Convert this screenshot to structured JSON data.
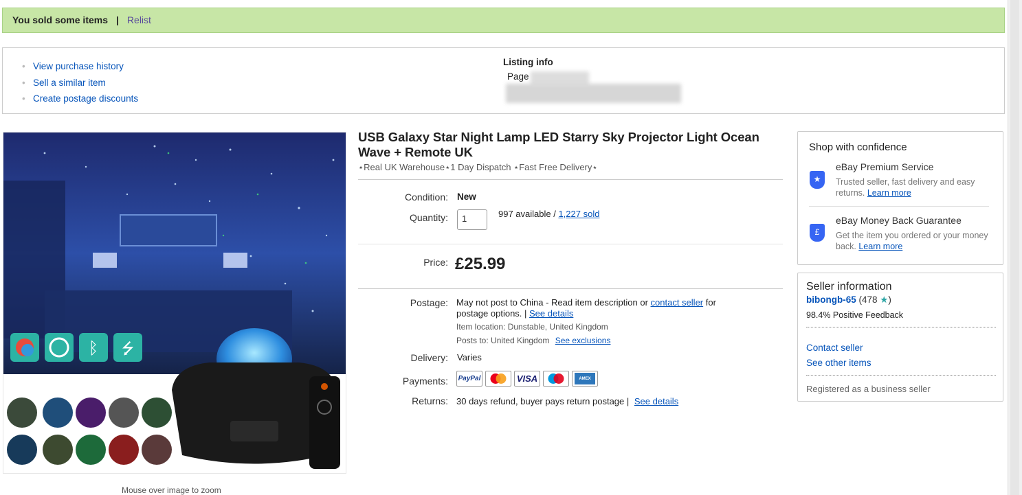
{
  "banner": {
    "message": "You sold some items",
    "separator": "|",
    "relist": "Relist"
  },
  "actions": {
    "items": [
      "View purchase history",
      "Sell a similar item",
      "Create postage discounts"
    ]
  },
  "listing_info": {
    "heading": "Listing info",
    "page_label": "Page"
  },
  "image": {
    "zoom_hint": "Mouse over image to zoom"
  },
  "product": {
    "title": "USB Galaxy Star Night Lamp LED Starry Sky Projector Light Ocean Wave + Remote UK",
    "subtitle": "⋆Real UK Warehouse⋆1 Day Dispatch ⋆Fast Free Delivery⋆",
    "condition_label": "Condition:",
    "condition": "New",
    "quantity_label": "Quantity:",
    "quantity_value": "1",
    "available": "997 available / ",
    "sold": "1,227 sold",
    "price_label": "Price:",
    "price": "£25.99",
    "postage_label": "Postage:",
    "postage_text_1": "May not post to China - Read item description or ",
    "contact_seller_link": "contact seller",
    "postage_text_2": " for",
    "postage_text_3": "postage options. | ",
    "see_details_postage": "See details",
    "item_location": "Item location:  Dunstable, United Kingdom",
    "posts_to": "Posts to:  United Kingdom",
    "see_exclusions": "See exclusions",
    "delivery_label": "Delivery:",
    "delivery": "Varies",
    "payments_label": "Payments:",
    "payments": [
      "PayPal",
      "Mastercard",
      "VISA",
      "Maestro",
      "AMEX"
    ],
    "returns_label": "Returns:",
    "returns": "30 days refund, buyer pays return postage | ",
    "see_details_returns": "See details"
  },
  "confidence": {
    "heading": "Shop with confidence",
    "premium_title": "eBay Premium Service",
    "premium_desc": "Trusted seller, fast delivery and easy returns. ",
    "premium_link": "Learn more",
    "mbg_title": "eBay Money Back Guarantee",
    "mbg_desc": "Get the item you ordered or your money back. ",
    "mbg_link": "Learn more"
  },
  "seller": {
    "heading": "Seller information",
    "name": "bibongb-65",
    "score_open": "(478 ",
    "score_close": ")",
    "feedback": "98.4% Positive Feedback",
    "contact": "Contact seller",
    "other_items": "See other items",
    "registered": "Registered as a business seller"
  },
  "colors": {
    "banner_bg": "#c7e6a6",
    "link": "#0654ba",
    "accent_star": "#2ca5a5"
  }
}
